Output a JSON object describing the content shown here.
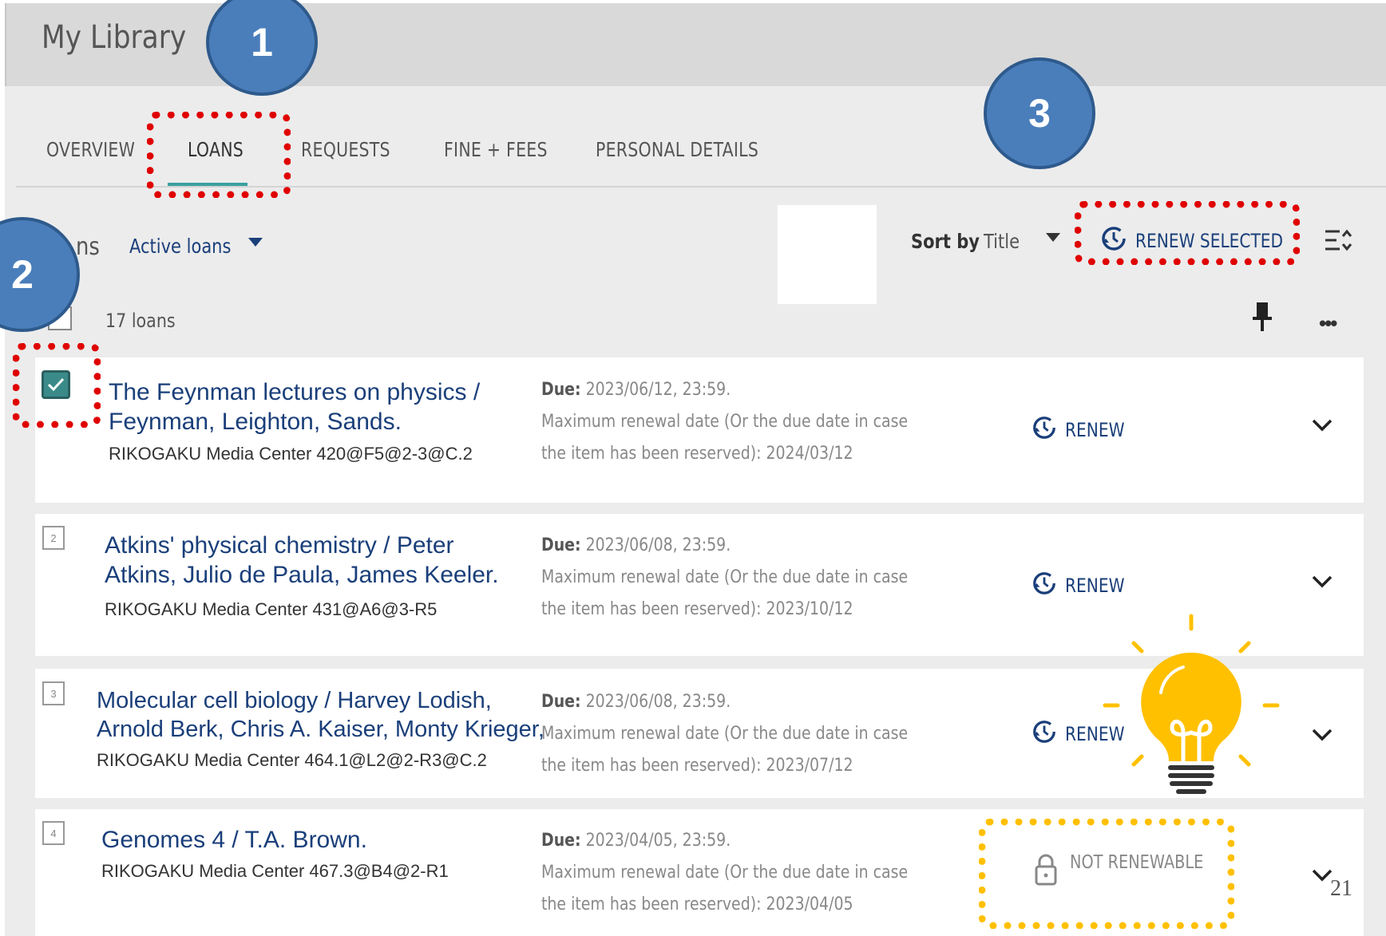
{
  "header": {
    "title": "My Library"
  },
  "tabs": [
    "OVERVIEW",
    "LOANS",
    "REQUESTS",
    "FINE + FEES",
    "PERSONAL DETAILS"
  ],
  "toolbar": {
    "section_partial": "ns",
    "filter_label": "Active loans",
    "sort_label": "Sort by",
    "sort_value": "Title",
    "renew_selected": "RENEW SELECTED",
    "count": "17 loans"
  },
  "badges": [
    "1",
    "2",
    "3"
  ],
  "loans": [
    {
      "num": "",
      "title_lines": [
        "The Feynman lectures on physics /",
        "Feynman, Leighton, Sands."
      ],
      "location": "RIKOGAKU Media Center 420@F5@2-3@C.2",
      "due_label": "Due:",
      "due": " 2023/06/12, 23:59.",
      "max_text": "Maximum renewal date (Or the due date in case the item has been reserved): 2024/03/12",
      "action": "RENEW",
      "checked": true
    },
    {
      "num": "2",
      "title_lines": [
        "Atkins' physical chemistry / Peter",
        "Atkins, Julio de Paula, James Keeler."
      ],
      "location": "RIKOGAKU Media Center 431@A6@3-R5",
      "due_label": "Due:",
      "due": " 2023/06/08, 23:59.",
      "max_text": "Maximum renewal date (Or the due date in case the item has been reserved): 2023/10/12",
      "action": "RENEW",
      "checked": false
    },
    {
      "num": "3",
      "title_lines": [
        "Molecular cell biology / Harvey Lodish,",
        "Arnold Berk, Chris A. Kaiser, Monty Krieger,"
      ],
      "location": "RIKOGAKU Media Center 464.1@L2@2-R3@C.2",
      "due_label": "Due:",
      "due": " 2023/06/08, 23:59.",
      "max_text": "Maximum renewal date (Or the due date in case the item has been reserved): 2023/07/12",
      "action": "RENEW",
      "checked": false
    },
    {
      "num": "4",
      "title_lines": [
        "Genomes 4 / T.A. Brown."
      ],
      "location": "RIKOGAKU Media Center 467.3@B4@2-R1",
      "due_label": "Due:",
      "due": " 2023/04/05, 23:59.",
      "max_text": "Maximum renewal date (Or the due date in case the item has been reserved): 2023/04/05",
      "action": "NOT RENEWABLE",
      "checked": false
    }
  ],
  "page_number": "21",
  "colors": {
    "accent": "#1a3f7a",
    "highlight_red": "#e00000",
    "highlight_yellow": "#ffc000",
    "badge": "#4a7ebb"
  }
}
